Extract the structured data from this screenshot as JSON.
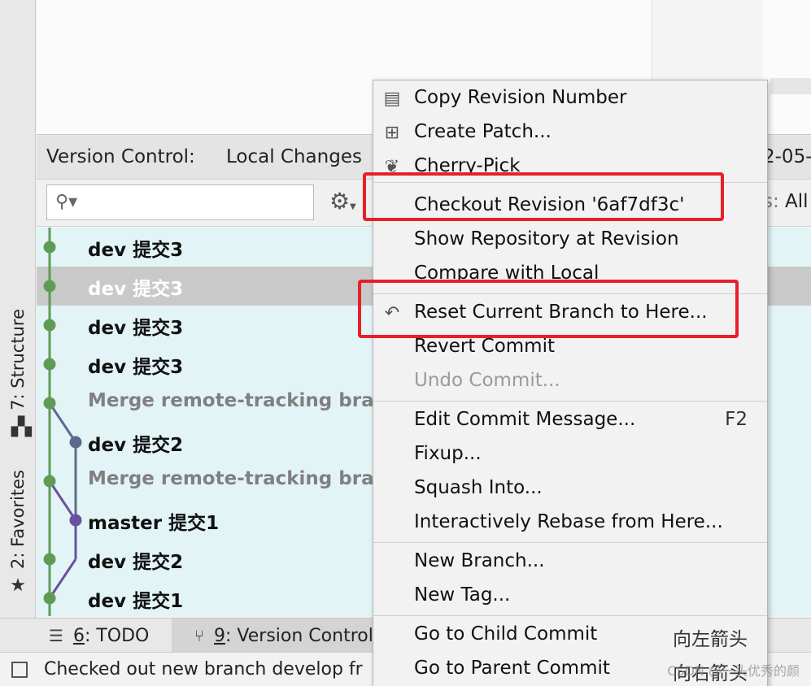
{
  "sidebar": {
    "tabs": [
      {
        "label": "7: Structure",
        "icon": "structure-icon"
      },
      {
        "label": "2: Favorites",
        "icon": "star-icon"
      }
    ]
  },
  "vc_panel": {
    "title": "Version Control:",
    "tab_local_changes": "Local Changes",
    "date_fragment": "2-05-",
    "search": {
      "value": "",
      "placeholder": ""
    },
    "filter_fragment_prefix": "s: ",
    "filter_fragment_value": "All"
  },
  "log": {
    "commits": [
      {
        "message": "dev 提交3",
        "type": "commit",
        "selected": false
      },
      {
        "message": "dev 提交3",
        "type": "commit",
        "selected": true
      },
      {
        "message": "dev 提交3",
        "type": "commit",
        "selected": false
      },
      {
        "message": "dev 提交3",
        "type": "commit",
        "selected": false
      },
      {
        "message": "Merge remote-tracking branc",
        "type": "merge",
        "selected": false
      },
      {
        "message": "dev 提交2",
        "type": "commit",
        "selected": false
      },
      {
        "message": "Merge remote-tracking branc",
        "type": "merge",
        "selected": false
      },
      {
        "message": "master 提交1",
        "type": "commit",
        "selected": false
      },
      {
        "message": "dev 提交2",
        "type": "commit",
        "selected": false
      },
      {
        "message": "dev 提交1",
        "type": "commit",
        "selected": false
      }
    ],
    "colors": {
      "main_branch": "#5f9b57",
      "side_branch_a": "#5c6a8e",
      "side_branch_b": "#6a4fa0"
    }
  },
  "context_menu": {
    "items": [
      {
        "label": "Copy Revision Number",
        "icon": "copy-icon",
        "shortcut": "",
        "enabled": true
      },
      {
        "label": "Create Patch...",
        "icon": "patch-icon",
        "shortcut": "",
        "enabled": true
      },
      {
        "label": "Cherry-Pick",
        "icon": "cherry-icon",
        "shortcut": "",
        "enabled": true
      },
      {
        "label": "Checkout Revision '6af7df3c'",
        "icon": "",
        "shortcut": "",
        "enabled": true
      },
      {
        "label": "Show Repository at Revision",
        "icon": "",
        "shortcut": "",
        "enabled": true
      },
      {
        "label": "Compare with Local",
        "icon": "",
        "shortcut": "",
        "enabled": true
      },
      {
        "label": "Reset Current Branch to Here...",
        "icon": "undo-icon",
        "shortcut": "",
        "enabled": true
      },
      {
        "label": "Revert Commit",
        "icon": "",
        "shortcut": "",
        "enabled": true
      },
      {
        "label": "Undo Commit...",
        "icon": "",
        "shortcut": "",
        "enabled": false
      },
      {
        "label": "Edit Commit Message...",
        "icon": "",
        "shortcut": "F2",
        "enabled": true
      },
      {
        "label": "Fixup...",
        "icon": "",
        "shortcut": "",
        "enabled": true
      },
      {
        "label": "Squash Into...",
        "icon": "",
        "shortcut": "",
        "enabled": true
      },
      {
        "label": "Interactively Rebase from Here...",
        "icon": "",
        "shortcut": "",
        "enabled": true
      },
      {
        "label": "New Branch...",
        "icon": "",
        "shortcut": "",
        "enabled": true
      },
      {
        "label": "New Tag...",
        "icon": "",
        "shortcut": "",
        "enabled": true
      },
      {
        "label": "Go to Child Commit",
        "icon": "",
        "shortcut": "向左箭头",
        "enabled": true
      },
      {
        "label": "Go to Parent Commit",
        "icon": "",
        "shortcut": "向右箭头",
        "enabled": true
      }
    ],
    "highlight_color": "#e5202a"
  },
  "bottom_tabs": {
    "todo": {
      "number": "6",
      "label": ": TODO"
    },
    "version_control": {
      "number": "9",
      "label": ": Version Control"
    }
  },
  "status_bar": {
    "message": "Checked out new branch develop fr"
  },
  "watermark": "CSDN @一头优秀的颜"
}
